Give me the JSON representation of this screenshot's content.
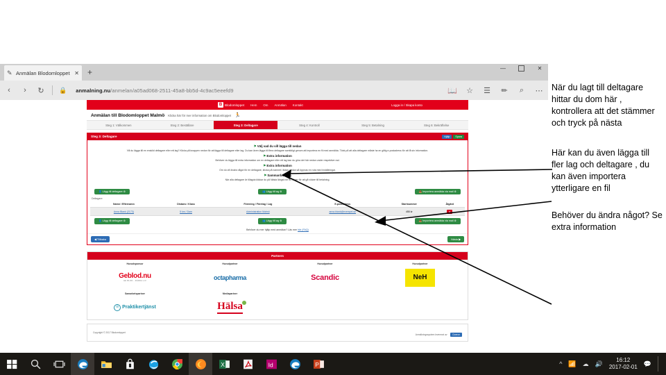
{
  "browser": {
    "tab": {
      "title": "Anmälan Blodomloppet",
      "favicon_icon": "document-edit-icon",
      "close_icon": "close-icon"
    },
    "new_tab_icon": "plus-icon",
    "window_controls": {
      "minimize": "minimize-icon",
      "maximize": "maximize-icon",
      "close": "close-icon"
    },
    "nav": {
      "back_icon": "back-arrow-icon",
      "forward_icon": "forward-arrow-icon",
      "refresh_icon": "refresh-icon",
      "lock_icon": "lock-icon",
      "url_host": "anmalning.nu",
      "url_path": "/anmelan/a05ad068-2511-45a8-bb5d-4c9ac5eeefd9",
      "reading_view_icon": "book-icon",
      "favorite_icon": "star-icon",
      "hub_icon": "hub-icon",
      "note_icon": "note-pen-icon",
      "share_icon": "share-icon",
      "more_icon": "more-dots-icon"
    }
  },
  "site": {
    "brand": "Blodomloppet",
    "nav_links": [
      "Hem",
      "Om",
      "Anmälan",
      "Kontakt"
    ],
    "login_link": "Logga in / Skapa konto",
    "page_title": "Anmälan till Blodomloppet Malmö",
    "page_subtitle": "Klicka här för mer information om Blodomloppet",
    "runner_icon": "runner-icon",
    "steps": [
      {
        "label": "Steg 1: Välkommen",
        "active": false
      },
      {
        "label": "Steg 2: Beställare",
        "active": false
      },
      {
        "label": "Steg 3: Deltagare",
        "active": true
      },
      {
        "label": "Steg 4: Kontroll",
        "active": false
      },
      {
        "label": "Steg 5: Betalning",
        "active": false
      },
      {
        "label": "Steg 6: Bekräftelse",
        "active": false
      }
    ]
  },
  "panel": {
    "header": "Steg 3: Deltagare",
    "header_buttons": [
      {
        "label": "Hjälp",
        "color": "blue"
      },
      {
        "label": "Spara",
        "color": "green"
      }
    ],
    "heading_1": "Välj vad du vill lägga till nedan",
    "paragraph_1": "Vill du lägga till en enskild deltagare eller ett lag? Klicka på knappen nedan för att lägga till deltagare eller lag. Du kan även lägga till flera deltagare samtidigt genom att importera en fil med anmälda. Tänk på att alla deltagare måste ha en giltig e-postadress för att få sin information.",
    "heading_2": "Extra information",
    "paragraph_2": "Behöver du lägga till extra information om en deltagare eller ett lag kan du göra det här nedan under respektive rad.",
    "heading_3": "Extra information",
    "paragraph_3": "Om du vill ändra något för en deltagare, klicka på namnet i listan nedan så öppnas en ruta med inställningar.",
    "heading_4": "Sammanfattning",
    "paragraph_4": "När alla deltagare är tillagda klickar du på Nästa längst ner till höger för att gå vidare till betalning.",
    "buttons": [
      {
        "label": "Lägg till deltagare",
        "icon": "person-add-icon"
      },
      {
        "label": "Lägg till lag",
        "icon": "team-add-icon"
      },
      {
        "label": "Importera anmälda via mail",
        "icon": "import-icon"
      }
    ],
    "table": {
      "caption": "Deltagare",
      "columns": [
        "Namn / Efternamn",
        "Distans / Klass",
        "Förening / Företag / Lag",
        "E-postadress",
        "Startnummer",
        "Åtgärd"
      ],
      "rows": [
        {
          "name": "Anna Blank (2173)",
          "distance": "5 km / Dam",
          "team": "Administration Malmö",
          "email": "anna.blank@exempel.se",
          "start_number": "455 kr",
          "action_icon": "delete-icon"
        }
      ]
    },
    "footnote_prefix": "Behöver du mer hjälp med anmälan? Läs mer ",
    "footnote_link": "här (FAQ)",
    "back_button": {
      "label": "Tillbaka",
      "icon": "arrow-left-icon"
    },
    "next_button": {
      "label": "Nästa",
      "icon": "arrow-right-icon"
    }
  },
  "partners": {
    "header": "Partners",
    "row1": [
      {
        "category": "Huvudsponsor",
        "name": "Geblod.nu",
        "tagline": "GE BLOD - RÄDDA LIV"
      },
      {
        "category": "Huvudpartner",
        "name": "octapharma"
      },
      {
        "category": "Huvudpartner",
        "name": "Scandic"
      },
      {
        "category": "Huvudpartner",
        "name": "NeH"
      }
    ],
    "row2": [
      {
        "category": "Samarbetspartner",
        "name": "Praktikertjänst"
      },
      {
        "category": "Mediapartner",
        "name": "Hälsa"
      }
    ]
  },
  "site_footer": {
    "left": "Copyright © 2017 Blodomloppet",
    "right_text": "Anmälningssystem levererat av",
    "right_badge": "Ciceron"
  },
  "annotations": [
    "När du lagt till deltagare hittar du dom här , kontrollera att det stämmer och tryck på nästa",
    "Här kan du även lägga till fler lag och deltagare , du kan även importera ytterligare en fil",
    "Behöver du ändra något? Se extra information"
  ],
  "taskbar": {
    "items": [
      {
        "name": "start-button",
        "icon": "windows-logo-icon"
      },
      {
        "name": "search-button",
        "icon": "search-icon"
      },
      {
        "name": "task-view-button",
        "icon": "task-view-icon"
      },
      {
        "name": "edge-taskbar-button",
        "icon": "edge-icon"
      },
      {
        "name": "file-explorer-button",
        "icon": "folder-icon"
      },
      {
        "name": "microsoft-store-button",
        "icon": "store-bag-icon"
      },
      {
        "name": "internet-explorer-button",
        "icon": "ie-icon"
      },
      {
        "name": "chrome-button",
        "icon": "chrome-icon"
      },
      {
        "name": "firefox-button",
        "icon": "firefox-icon"
      },
      {
        "name": "excel-button",
        "icon": "excel-icon"
      },
      {
        "name": "acrobat-button",
        "icon": "acrobat-icon"
      },
      {
        "name": "indesign-button",
        "icon": "indesign-icon"
      },
      {
        "name": "edge-window-button",
        "icon": "edge-icon"
      },
      {
        "name": "powerpoint-button",
        "icon": "powerpoint-icon"
      }
    ],
    "tray": {
      "chevron_icon": "chevron-up-icon",
      "network_icon": "network-icon",
      "onedrive_icon": "onedrive-icon",
      "volume_icon": "volume-icon",
      "time": "16:12",
      "date": "2017-02-01",
      "action_center_icon": "action-center-icon"
    }
  },
  "colors": {
    "brand_red": "#e2001a",
    "step_active_red": "#d5001c",
    "green_button": "#2e8b43",
    "blue_button": "#2d6cb5",
    "taskbar": "#1b1915"
  }
}
